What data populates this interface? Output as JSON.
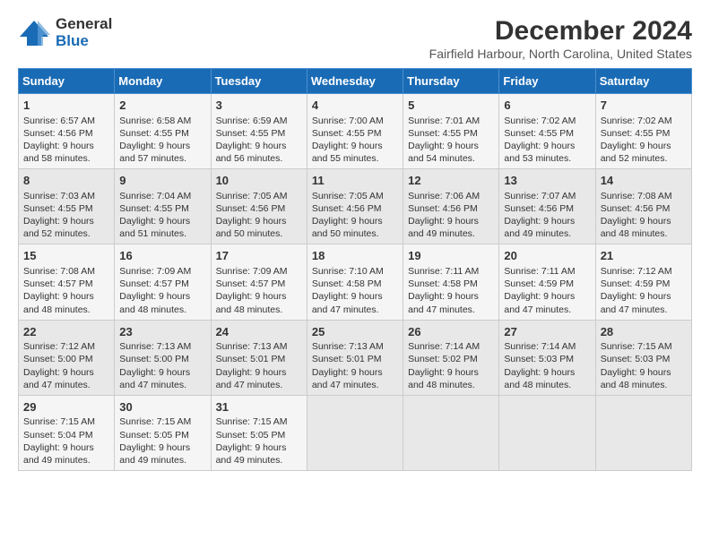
{
  "logo": {
    "general": "General",
    "blue": "Blue"
  },
  "header": {
    "title": "December 2024",
    "subtitle": "Fairfield Harbour, North Carolina, United States"
  },
  "weekdays": [
    "Sunday",
    "Monday",
    "Tuesday",
    "Wednesday",
    "Thursday",
    "Friday",
    "Saturday"
  ],
  "weeks": [
    [
      {
        "day": "1",
        "info": "Sunrise: 6:57 AM\nSunset: 4:56 PM\nDaylight: 9 hours\nand 58 minutes."
      },
      {
        "day": "2",
        "info": "Sunrise: 6:58 AM\nSunset: 4:55 PM\nDaylight: 9 hours\nand 57 minutes."
      },
      {
        "day": "3",
        "info": "Sunrise: 6:59 AM\nSunset: 4:55 PM\nDaylight: 9 hours\nand 56 minutes."
      },
      {
        "day": "4",
        "info": "Sunrise: 7:00 AM\nSunset: 4:55 PM\nDaylight: 9 hours\nand 55 minutes."
      },
      {
        "day": "5",
        "info": "Sunrise: 7:01 AM\nSunset: 4:55 PM\nDaylight: 9 hours\nand 54 minutes."
      },
      {
        "day": "6",
        "info": "Sunrise: 7:02 AM\nSunset: 4:55 PM\nDaylight: 9 hours\nand 53 minutes."
      },
      {
        "day": "7",
        "info": "Sunrise: 7:02 AM\nSunset: 4:55 PM\nDaylight: 9 hours\nand 52 minutes."
      }
    ],
    [
      {
        "day": "8",
        "info": "Sunrise: 7:03 AM\nSunset: 4:55 PM\nDaylight: 9 hours\nand 52 minutes."
      },
      {
        "day": "9",
        "info": "Sunrise: 7:04 AM\nSunset: 4:55 PM\nDaylight: 9 hours\nand 51 minutes."
      },
      {
        "day": "10",
        "info": "Sunrise: 7:05 AM\nSunset: 4:56 PM\nDaylight: 9 hours\nand 50 minutes."
      },
      {
        "day": "11",
        "info": "Sunrise: 7:05 AM\nSunset: 4:56 PM\nDaylight: 9 hours\nand 50 minutes."
      },
      {
        "day": "12",
        "info": "Sunrise: 7:06 AM\nSunset: 4:56 PM\nDaylight: 9 hours\nand 49 minutes."
      },
      {
        "day": "13",
        "info": "Sunrise: 7:07 AM\nSunset: 4:56 PM\nDaylight: 9 hours\nand 49 minutes."
      },
      {
        "day": "14",
        "info": "Sunrise: 7:08 AM\nSunset: 4:56 PM\nDaylight: 9 hours\nand 48 minutes."
      }
    ],
    [
      {
        "day": "15",
        "info": "Sunrise: 7:08 AM\nSunset: 4:57 PM\nDaylight: 9 hours\nand 48 minutes."
      },
      {
        "day": "16",
        "info": "Sunrise: 7:09 AM\nSunset: 4:57 PM\nDaylight: 9 hours\nand 48 minutes."
      },
      {
        "day": "17",
        "info": "Sunrise: 7:09 AM\nSunset: 4:57 PM\nDaylight: 9 hours\nand 48 minutes."
      },
      {
        "day": "18",
        "info": "Sunrise: 7:10 AM\nSunset: 4:58 PM\nDaylight: 9 hours\nand 47 minutes."
      },
      {
        "day": "19",
        "info": "Sunrise: 7:11 AM\nSunset: 4:58 PM\nDaylight: 9 hours\nand 47 minutes."
      },
      {
        "day": "20",
        "info": "Sunrise: 7:11 AM\nSunset: 4:59 PM\nDaylight: 9 hours\nand 47 minutes."
      },
      {
        "day": "21",
        "info": "Sunrise: 7:12 AM\nSunset: 4:59 PM\nDaylight: 9 hours\nand 47 minutes."
      }
    ],
    [
      {
        "day": "22",
        "info": "Sunrise: 7:12 AM\nSunset: 5:00 PM\nDaylight: 9 hours\nand 47 minutes."
      },
      {
        "day": "23",
        "info": "Sunrise: 7:13 AM\nSunset: 5:00 PM\nDaylight: 9 hours\nand 47 minutes."
      },
      {
        "day": "24",
        "info": "Sunrise: 7:13 AM\nSunset: 5:01 PM\nDaylight: 9 hours\nand 47 minutes."
      },
      {
        "day": "25",
        "info": "Sunrise: 7:13 AM\nSunset: 5:01 PM\nDaylight: 9 hours\nand 47 minutes."
      },
      {
        "day": "26",
        "info": "Sunrise: 7:14 AM\nSunset: 5:02 PM\nDaylight: 9 hours\nand 48 minutes."
      },
      {
        "day": "27",
        "info": "Sunrise: 7:14 AM\nSunset: 5:03 PM\nDaylight: 9 hours\nand 48 minutes."
      },
      {
        "day": "28",
        "info": "Sunrise: 7:15 AM\nSunset: 5:03 PM\nDaylight: 9 hours\nand 48 minutes."
      }
    ],
    [
      {
        "day": "29",
        "info": "Sunrise: 7:15 AM\nSunset: 5:04 PM\nDaylight: 9 hours\nand 49 minutes."
      },
      {
        "day": "30",
        "info": "Sunrise: 7:15 AM\nSunset: 5:05 PM\nDaylight: 9 hours\nand 49 minutes."
      },
      {
        "day": "31",
        "info": "Sunrise: 7:15 AM\nSunset: 5:05 PM\nDaylight: 9 hours\nand 49 minutes."
      },
      {
        "day": "",
        "info": ""
      },
      {
        "day": "",
        "info": ""
      },
      {
        "day": "",
        "info": ""
      },
      {
        "day": "",
        "info": ""
      }
    ]
  ]
}
